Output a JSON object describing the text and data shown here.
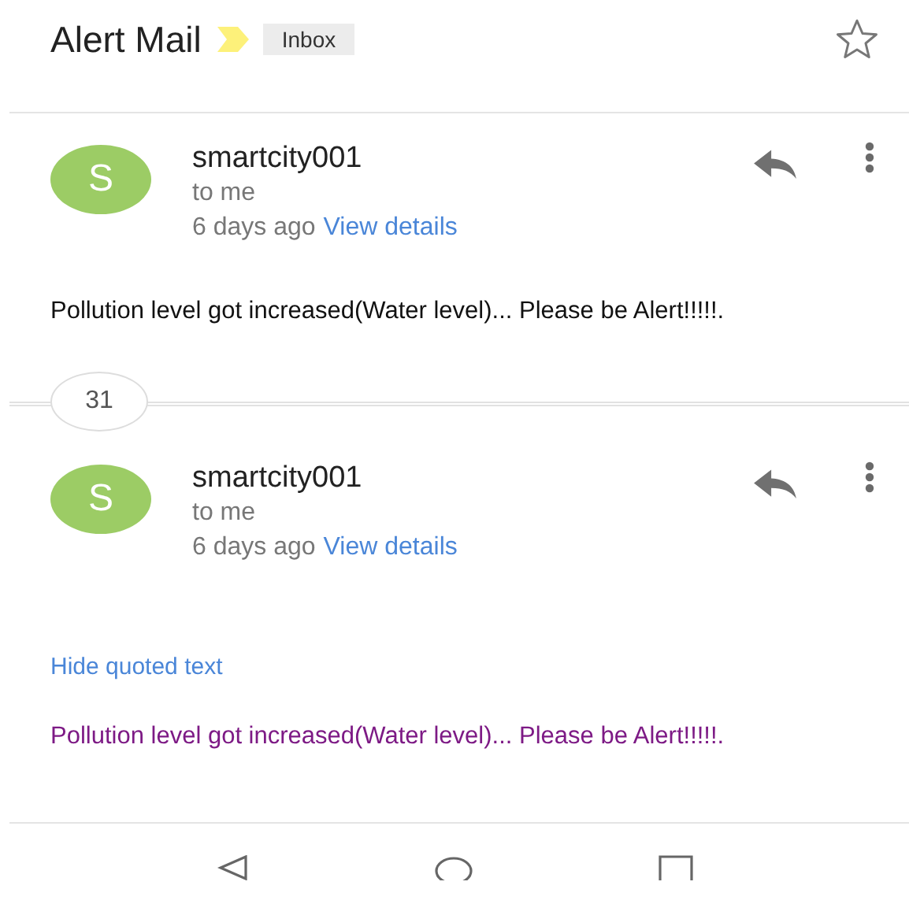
{
  "header": {
    "subject": "Alert Mail",
    "label": "Inbox",
    "important": true,
    "starred": false
  },
  "messages": [
    {
      "avatar": "S",
      "sender": "smartcity001",
      "recipient": "to me",
      "time": "6 days ago",
      "details_link": "View details",
      "body": "Pollution level got increased(Water level)... Please be Alert!!!!!.",
      "quoted": false
    },
    {
      "avatar": "S",
      "sender": "smartcity001",
      "recipient": "to me",
      "time": "6 days ago",
      "details_link": "View details",
      "quote_link": "Hide quoted text",
      "body": "Pollution level got increased(Water level)... Please be Alert!!!!!.",
      "quoted": true
    }
  ],
  "collapsed_count": "31"
}
